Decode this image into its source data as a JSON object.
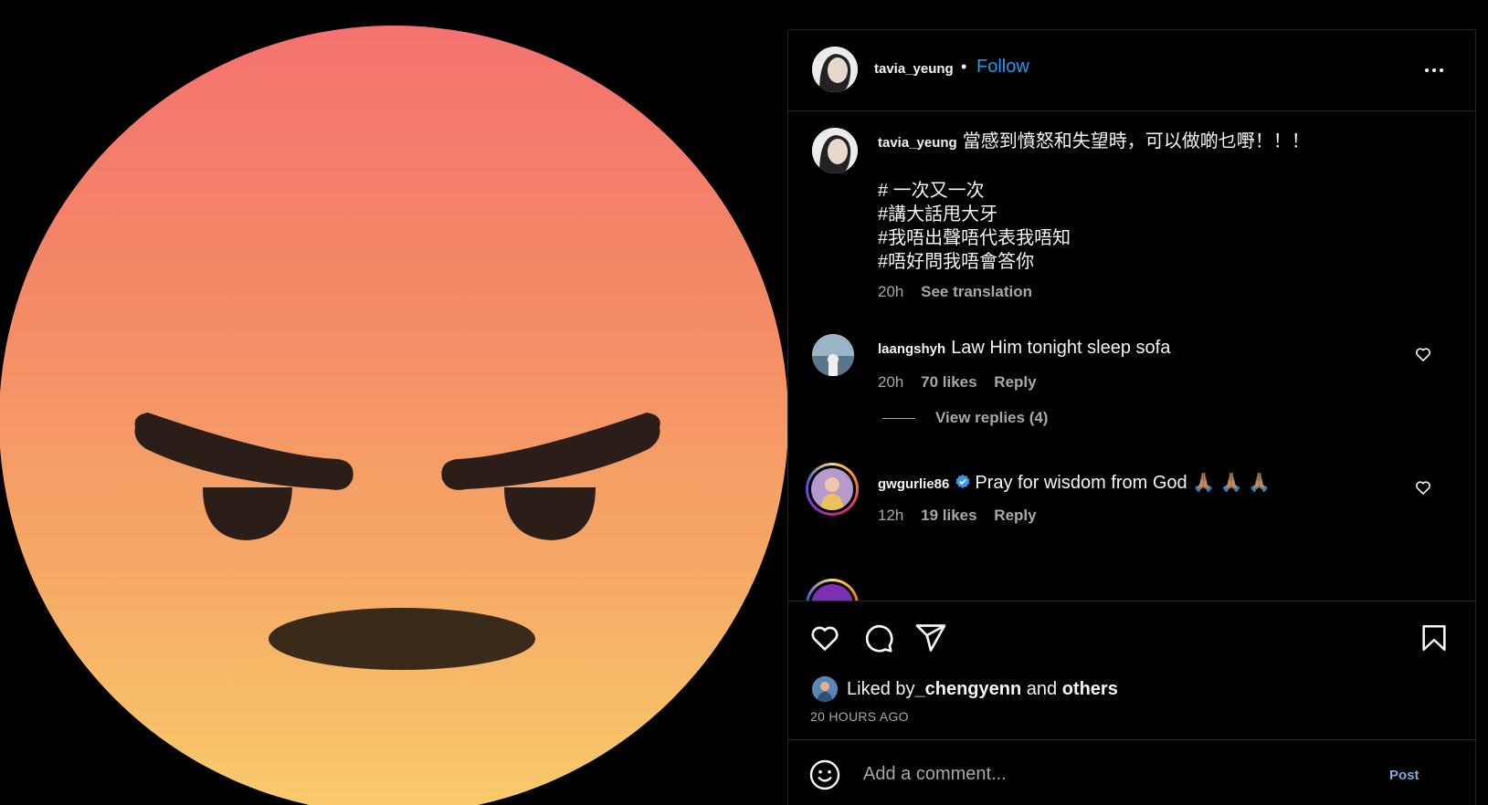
{
  "post": {
    "username": "tavia_yeung",
    "separator": "•",
    "follow_label": "Follow",
    "more_icon": "more-horizontal-icon"
  },
  "caption": {
    "username": "tavia_yeung",
    "text": "當感到憤怒和失望時，可以做啲乜嘢！！！",
    "hashtags": [
      "# 一次又一次",
      "#講大話甩大牙",
      "#我唔出聲唔代表我唔知",
      "#唔好問我唔會答你"
    ],
    "time": "20h",
    "see_translation": "See translation"
  },
  "comments": [
    {
      "username": "laangshyh",
      "text": "Law Him tonight sleep sofa",
      "time": "20h",
      "likes": "70 likes",
      "reply": "Reply",
      "view_replies": "View replies (4)"
    },
    {
      "username": "gwgurlie86",
      "verified": true,
      "text": "Pray for wisdom from God 🙏🏽 🙏🏽 🙏🏽",
      "time": "12h",
      "likes": "19 likes",
      "reply": "Reply"
    }
  ],
  "actions": {
    "icons": [
      "heart-icon",
      "comment-icon",
      "share-icon",
      "bookmark-icon"
    ],
    "liked_by_prefix": "Liked by ",
    "liked_by_user": "_chengyenn",
    "liked_by_and": " and ",
    "liked_by_others": "others",
    "timestamp": "20 HOURS AGO"
  },
  "add_comment": {
    "placeholder": "Add a comment...",
    "post_label": "Post",
    "emoji_icon": "emoji-icon"
  },
  "colors": {
    "accent": "#1d9bf0",
    "background": "#000000",
    "muted": "#a8a8a8",
    "angry_top": "#f47272",
    "angry_bottom": "#f9c96a"
  }
}
